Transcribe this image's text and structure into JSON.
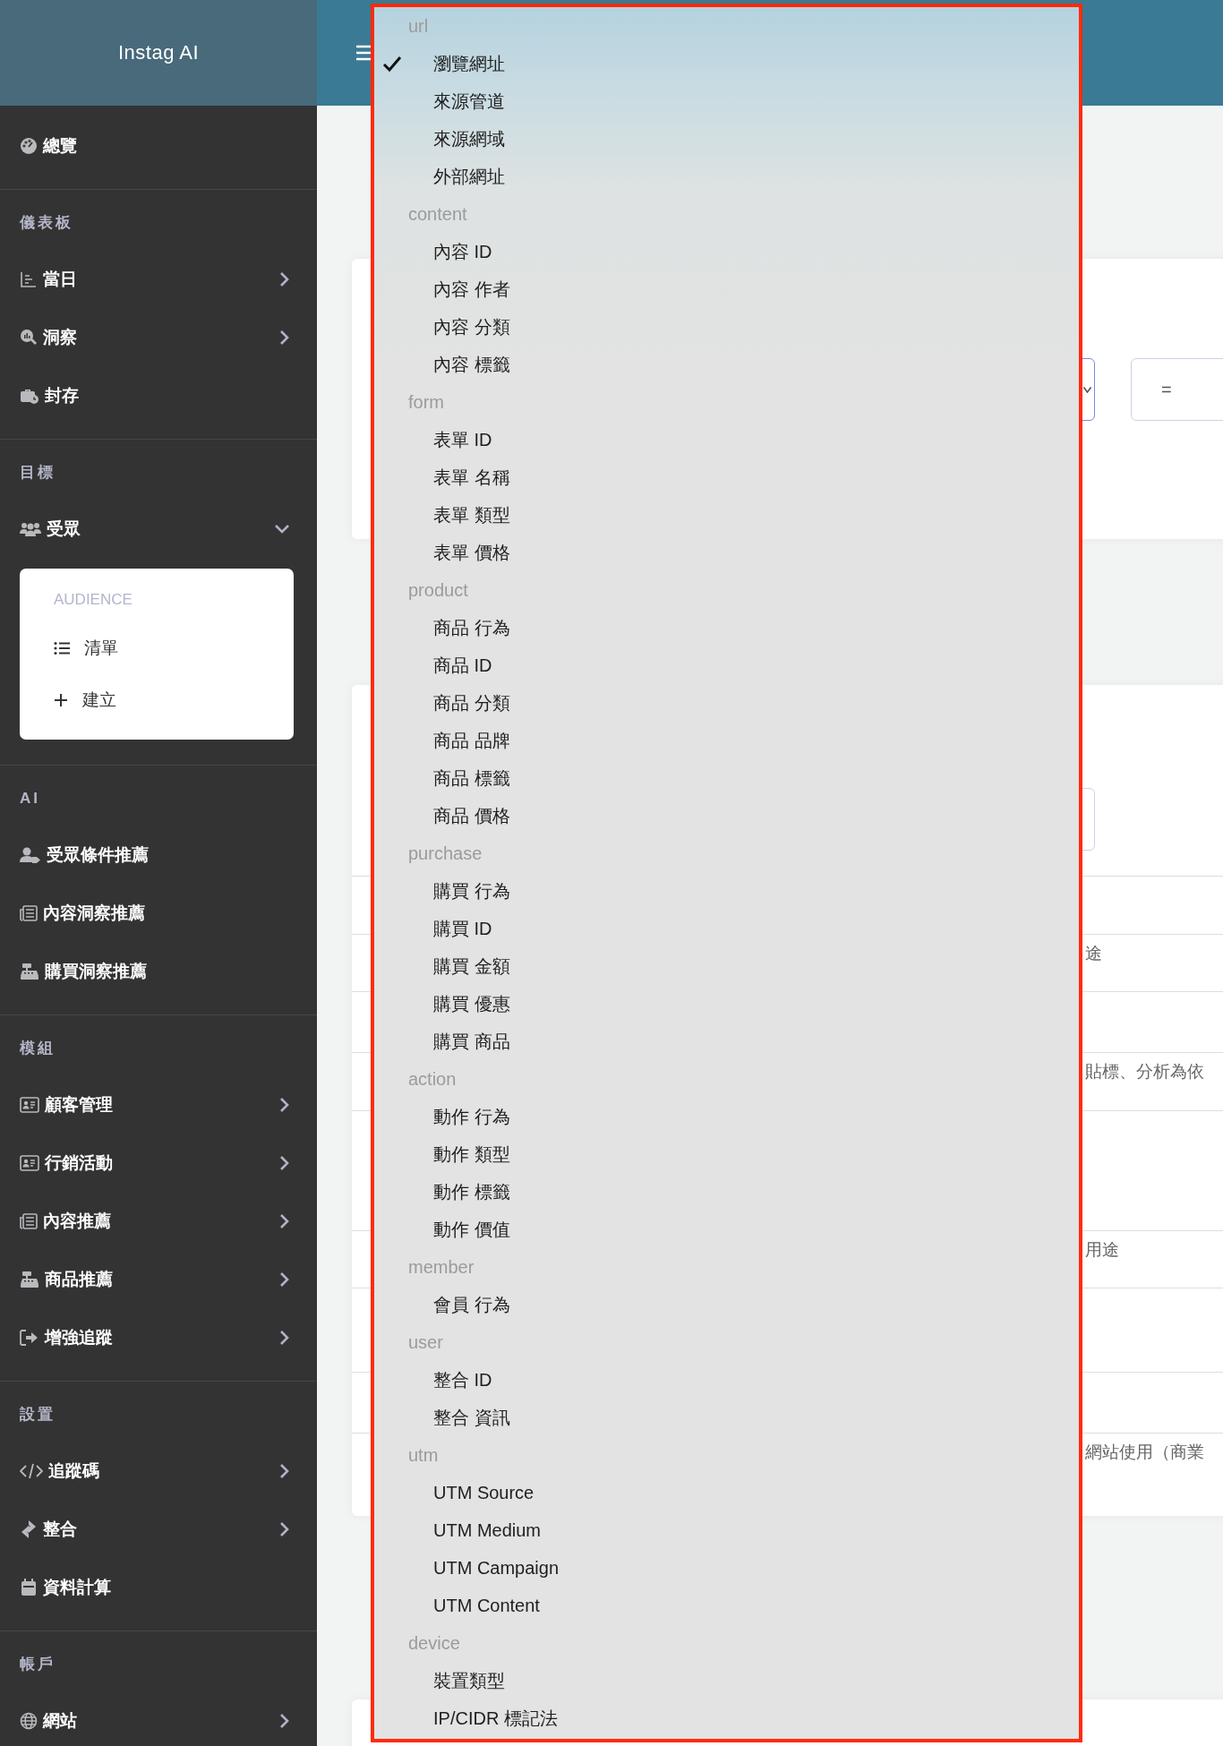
{
  "sidebar": {
    "brand": "Instag AI",
    "sections": [
      {
        "items": [
          {
            "label": "總覽",
            "kind": "link"
          }
        ]
      },
      {
        "heading": "儀表板",
        "items": [
          {
            "label": "當日",
            "kind": "submenu",
            "expanded": false
          },
          {
            "label": "洞察",
            "kind": "submenu",
            "expanded": false
          },
          {
            "label": "封存",
            "kind": "link"
          }
        ]
      },
      {
        "heading": "目標",
        "items": [
          {
            "label": "受眾",
            "kind": "submenu",
            "expanded": true,
            "submenu": {
              "title": "AUDIENCE",
              "items": [
                {
                  "label": "清單"
                },
                {
                  "label": "建立"
                }
              ]
            }
          }
        ]
      },
      {
        "heading": "AI",
        "items": [
          {
            "label": "受眾條件推薦",
            "kind": "link"
          },
          {
            "label": "內容洞察推薦",
            "kind": "link"
          },
          {
            "label": "購買洞察推薦",
            "kind": "link"
          }
        ]
      },
      {
        "heading": "模組",
        "items": [
          {
            "label": "顧客管理",
            "kind": "submenu",
            "expanded": false
          },
          {
            "label": "行銷活動",
            "kind": "submenu",
            "expanded": false
          },
          {
            "label": "內容推薦",
            "kind": "submenu",
            "expanded": false
          },
          {
            "label": "商品推薦",
            "kind": "submenu",
            "expanded": false
          },
          {
            "label": "增強追蹤",
            "kind": "submenu",
            "expanded": false
          }
        ]
      },
      {
        "heading": "設置",
        "items": [
          {
            "label": "追蹤碼",
            "kind": "submenu",
            "expanded": false
          },
          {
            "label": "整合",
            "kind": "submenu",
            "expanded": false
          },
          {
            "label": "資料計算",
            "kind": "link"
          }
        ]
      },
      {
        "heading": "帳戶",
        "items": [
          {
            "label": "網站",
            "kind": "submenu",
            "expanded": false
          }
        ]
      }
    ]
  },
  "main": {
    "filter": {
      "operator": "="
    },
    "table_cells": [
      "途",
      "貼標、分析為依",
      "用途",
      "網站使用（商業"
    ]
  },
  "dropdown": {
    "groups": [
      {
        "label": "url",
        "options": [
          {
            "label": "瀏覽網址",
            "selected": true
          },
          {
            "label": "來源管道",
            "selected": false
          },
          {
            "label": "來源網域",
            "selected": false
          },
          {
            "label": "外部網址",
            "selected": false
          }
        ]
      },
      {
        "label": "content",
        "options": [
          {
            "label": "內容 ID",
            "selected": false
          },
          {
            "label": "內容 作者",
            "selected": false
          },
          {
            "label": "內容 分類",
            "selected": false
          },
          {
            "label": "內容 標籤",
            "selected": false
          }
        ]
      },
      {
        "label": "form",
        "options": [
          {
            "label": "表單 ID",
            "selected": false
          },
          {
            "label": "表單 名稱",
            "selected": false
          },
          {
            "label": "表單 類型",
            "selected": false
          },
          {
            "label": "表單 價格",
            "selected": false
          }
        ]
      },
      {
        "label": "product",
        "options": [
          {
            "label": "商品 行為",
            "selected": false
          },
          {
            "label": "商品 ID",
            "selected": false
          },
          {
            "label": "商品 分類",
            "selected": false
          },
          {
            "label": "商品 品牌",
            "selected": false
          },
          {
            "label": "商品 標籤",
            "selected": false
          },
          {
            "label": "商品 價格",
            "selected": false
          }
        ]
      },
      {
        "label": "purchase",
        "options": [
          {
            "label": "購買 行為",
            "selected": false
          },
          {
            "label": "購買 ID",
            "selected": false
          },
          {
            "label": "購買 金額",
            "selected": false
          },
          {
            "label": "購買 優惠",
            "selected": false
          },
          {
            "label": "購買 商品",
            "selected": false
          }
        ]
      },
      {
        "label": "action",
        "options": [
          {
            "label": "動作 行為",
            "selected": false
          },
          {
            "label": "動作 類型",
            "selected": false
          },
          {
            "label": "動作 標籤",
            "selected": false
          },
          {
            "label": "動作 價值",
            "selected": false
          }
        ]
      },
      {
        "label": "member",
        "options": [
          {
            "label": "會員 行為",
            "selected": false
          }
        ]
      },
      {
        "label": "user",
        "options": [
          {
            "label": "整合 ID",
            "selected": false
          },
          {
            "label": "整合 資訊",
            "selected": false
          }
        ]
      },
      {
        "label": "utm",
        "options": [
          {
            "label": "UTM Source",
            "selected": false
          },
          {
            "label": "UTM Medium",
            "selected": false
          },
          {
            "label": "UTM Campaign",
            "selected": false
          },
          {
            "label": "UTM Content",
            "selected": false
          }
        ]
      },
      {
        "label": "device",
        "options": [
          {
            "label": "裝置類型",
            "selected": false
          },
          {
            "label": "IP/CIDR 標記法",
            "selected": false
          }
        ]
      }
    ]
  }
}
